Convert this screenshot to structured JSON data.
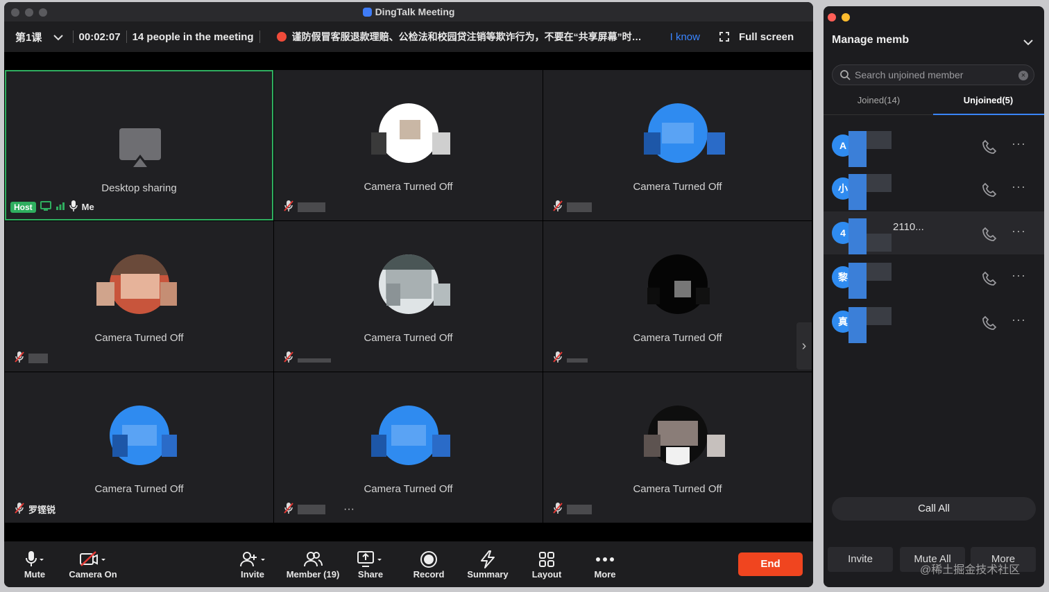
{
  "window": {
    "title": "DingTalk Meeting"
  },
  "infobar": {
    "course": "第1课",
    "timer": "00:02:07",
    "people": "14 people in the meeting",
    "notice": "谨防假冒客服退款理赔、公检法和校园贷注销等欺诈行为，不要在“共享屏幕”时…",
    "i_know": "I know",
    "fullscreen": "Full screen"
  },
  "tiles": [
    {
      "type": "share",
      "label": "Desktop sharing",
      "host_badge": "Host",
      "me_label": "Me"
    },
    {
      "type": "camera",
      "label": "Camera Turned Off",
      "name": ""
    },
    {
      "type": "camera",
      "label": "Camera Turned Off",
      "name": ""
    },
    {
      "type": "camera",
      "label": "Camera Turned Off",
      "name": ""
    },
    {
      "type": "camera",
      "label": "Camera Turned Off",
      "name": ""
    },
    {
      "type": "camera",
      "label": "Camera Turned Off",
      "name": ""
    },
    {
      "type": "camera",
      "label": "Camera Turned Off",
      "name": "罗铿锐"
    },
    {
      "type": "camera",
      "label": "Camera Turned Off",
      "name": "",
      "more": "···"
    },
    {
      "type": "camera",
      "label": "Camera Turned Off",
      "name": ""
    }
  ],
  "toolbar": {
    "mute": "Mute",
    "camera": "Camera On",
    "invite": "Invite",
    "member": "Member (19)",
    "share": "Share",
    "record": "Record",
    "summary": "Summary",
    "layout": "Layout",
    "more": "More",
    "end": "End"
  },
  "side": {
    "title": "Manage memb",
    "search_placeholder": "Search unjoined member",
    "tabs": [
      "Joined(14)",
      "Unjoined(5)"
    ],
    "members": [
      {
        "initial": "A",
        "name": ""
      },
      {
        "initial": "小",
        "name": ""
      },
      {
        "initial": "4",
        "name": "2110..."
      },
      {
        "initial": "黎",
        "name": ""
      },
      {
        "initial": "真",
        "name": ""
      }
    ],
    "call_all": "Call All",
    "invite": "Invite",
    "mute_all": "Mute All",
    "more": "More"
  },
  "watermark": "@稀土掘金技术社区",
  "colors": {
    "accent": "#3a85ff",
    "host_green": "#2fae5f",
    "end_red": "#f0451f",
    "avatar_blue": "#2f8bf0"
  }
}
